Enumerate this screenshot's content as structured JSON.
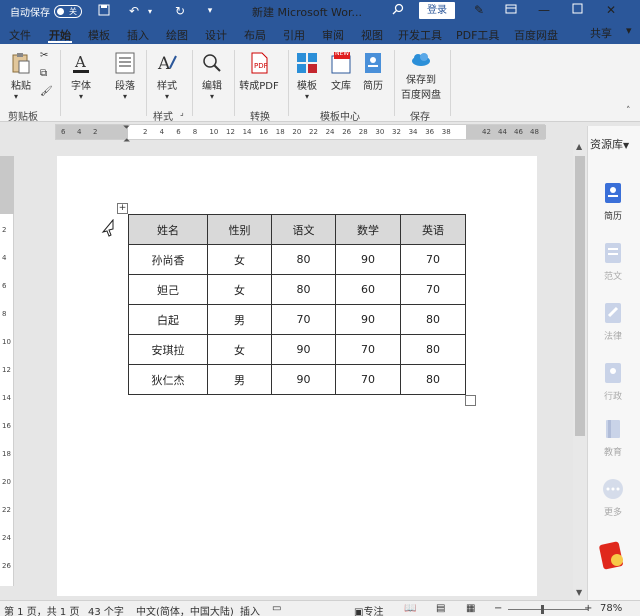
{
  "titlebar": {
    "autosave_label": "自动保存",
    "autosave_state": "关",
    "title": "新建 Microsoft Wor...",
    "login_label": "登录"
  },
  "tabs": [
    "文件",
    "开始",
    "模板",
    "插入",
    "绘图",
    "设计",
    "布局",
    "引用",
    "审阅",
    "视图",
    "开发工具",
    "PDF工具",
    "百度网盘"
  ],
  "active_tab": "开始",
  "share_label": "共享",
  "ribbon": {
    "paste": "粘贴",
    "font": "字体",
    "paragraph": "段落",
    "styles": "样式",
    "editing": "编辑",
    "to_pdf": "转成PDF",
    "template": "模板",
    "wenku": "文库",
    "resume": "简历",
    "save_to": "保存到",
    "baidu_disk": "百度网盘",
    "new_badge": "NEW",
    "groups": {
      "clipboard": "剪贴板",
      "styles": "样式",
      "convert": "转换",
      "template_center": "模板中心",
      "save": "保存"
    }
  },
  "ruler": {
    "left_numbers": [
      "6",
      "4",
      "2"
    ],
    "numbers": [
      "2",
      "4",
      "6",
      "8",
      "10",
      "12",
      "14",
      "16",
      "18",
      "20",
      "22",
      "24",
      "26",
      "28",
      "30",
      "32",
      "34",
      "36",
      "38"
    ],
    "right_numbers": [
      "42",
      "44",
      "46",
      "48"
    ]
  },
  "vruler": {
    "numbers": [
      "2",
      "4",
      "6",
      "8",
      "10",
      "12",
      "14",
      "16",
      "18",
      "20",
      "22",
      "24",
      "26"
    ]
  },
  "table": {
    "headers": [
      "姓名",
      "性别",
      "语文",
      "数学",
      "英语"
    ],
    "rows": [
      [
        "孙尚香",
        "女",
        "80",
        "90",
        "70"
      ],
      [
        "妲己",
        "女",
        "80",
        "60",
        "70"
      ],
      [
        "白起",
        "男",
        "70",
        "90",
        "80"
      ],
      [
        "安琪拉",
        "女",
        "90",
        "70",
        "80"
      ],
      [
        "狄仁杰",
        "男",
        "90",
        "70",
        "80"
      ]
    ]
  },
  "right_panel": {
    "title": "资源库",
    "items": [
      "简历",
      "范文",
      "法律",
      "行政",
      "教育",
      "更多"
    ]
  },
  "statusbar": {
    "page_info": "第 1 页，共 1 页",
    "word_count": "43 个字",
    "language": "中文(简体，中国大陆)",
    "insert_mode": "插入",
    "focus": "专注",
    "zoom": "78%"
  },
  "colors": {
    "accent": "#2b579a",
    "header_fill": "#d9d9d9"
  }
}
